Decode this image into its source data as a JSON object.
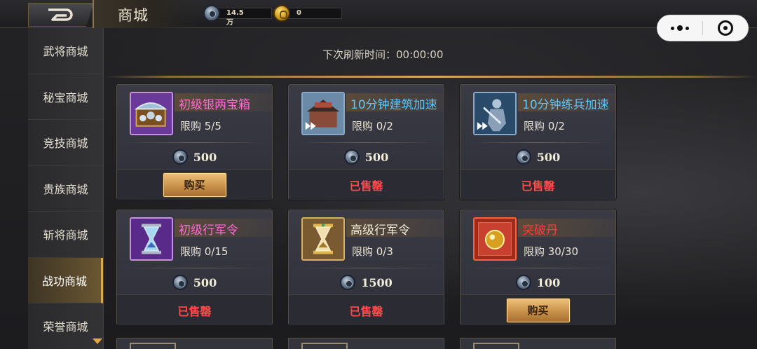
{
  "header": {
    "title": "商城",
    "silver_amount": "14.5万",
    "gold_amount": "0"
  },
  "sidebar": {
    "items": [
      {
        "label": "武将商城",
        "active": false
      },
      {
        "label": "秘宝商城",
        "active": false
      },
      {
        "label": "竞技商城",
        "active": false
      },
      {
        "label": "贵族商城",
        "active": false
      },
      {
        "label": "斩将商城",
        "active": false
      },
      {
        "label": "战功商城",
        "active": true
      },
      {
        "label": "荣誉商城",
        "active": false
      }
    ]
  },
  "refresh": {
    "text": "下次刷新时间：00:00:00"
  },
  "labels": {
    "buy": "购买",
    "sold_out": "已售罄"
  },
  "items": [
    {
      "name": "初级银两宝箱",
      "name_color": "#ff6ad5",
      "limit": "限购 5/5",
      "price": "500",
      "status": "buy",
      "icon": "silver-chest-icon"
    },
    {
      "name": "10分钟建筑加速",
      "name_color": "#5ac8ff",
      "limit": "限购 0/2",
      "price": "500",
      "status": "sold",
      "icon": "building-speedup-icon"
    },
    {
      "name": "10分钟练兵加速",
      "name_color": "#5ac8ff",
      "limit": "限购 0/2",
      "price": "500",
      "status": "sold",
      "icon": "training-speedup-icon"
    },
    {
      "name": "初级行军令",
      "name_color": "#ff6ad5",
      "limit": "限购 0/15",
      "price": "500",
      "status": "sold",
      "icon": "hourglass-purple-icon"
    },
    {
      "name": "高级行军令",
      "name_color": "#f2ead6",
      "limit": "限购 0/3",
      "price": "1500",
      "status": "sold",
      "icon": "hourglass-gold-icon"
    },
    {
      "name": "突破丹",
      "name_color": "#ff3a3a",
      "limit": "限购 30/30",
      "price": "100",
      "status": "buy",
      "icon": "breakthrough-pill-icon"
    }
  ],
  "colors": {
    "accent_gold": "#d4a860",
    "sold_red": "#ff4a4a",
    "purple_rarity": "#ff6ad5",
    "blue_rarity": "#5ac8ff"
  }
}
